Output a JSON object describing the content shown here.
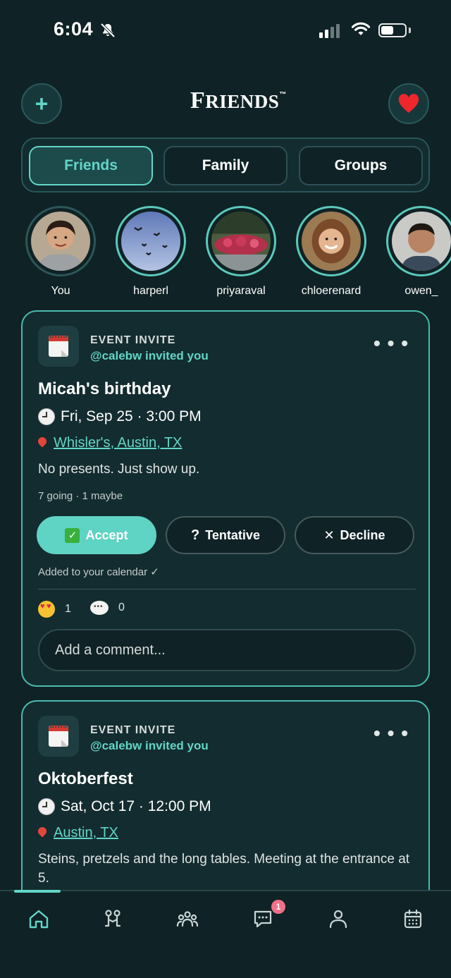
{
  "status_bar": {
    "time": "6:04"
  },
  "header": {
    "logo_big": "F",
    "logo_rest": "RIENDS",
    "logo_mark": "™"
  },
  "tabs": [
    {
      "label": "Friends",
      "active": true
    },
    {
      "label": "Family",
      "active": false
    },
    {
      "label": "Groups",
      "active": false
    }
  ],
  "stories": [
    {
      "name": "You"
    },
    {
      "name": "harperl"
    },
    {
      "name": "priyaraval"
    },
    {
      "name": "chloerenard"
    },
    {
      "name": "owen_"
    }
  ],
  "posts": [
    {
      "label": "EVENT INVITE",
      "invited_by": "@calebw invited you",
      "title": "Micah's birthday",
      "when": "Fri, Sep 25 · 3:00 PM",
      "where": "Whisler's, Austin, TX",
      "description": "No presents. Just show up.",
      "stats": "7 going · 1 maybe",
      "accept_label": "Accept",
      "accept_icon": "✓",
      "tentative_label": "Tentative",
      "tentative_icon": "?",
      "decline_label": "Decline",
      "decline_icon": "✕",
      "added_note": "Added to your calendar ✓",
      "love_count": "1",
      "comment_count": "0",
      "comment_placeholder": "Add a comment..."
    },
    {
      "label": "EVENT INVITE",
      "invited_by": "@calebw invited you",
      "title": "Oktoberfest",
      "when": "Sat, Oct 17 · 12:00 PM",
      "where": "Austin, TX",
      "description": "Steins, pretzels and the long tables. Meeting at the entrance at 5."
    }
  ],
  "nav": {
    "messages_badge": "1"
  },
  "colors": {
    "accent": "#62d5c7",
    "background": "#0f2225",
    "card": "#132c2f"
  }
}
